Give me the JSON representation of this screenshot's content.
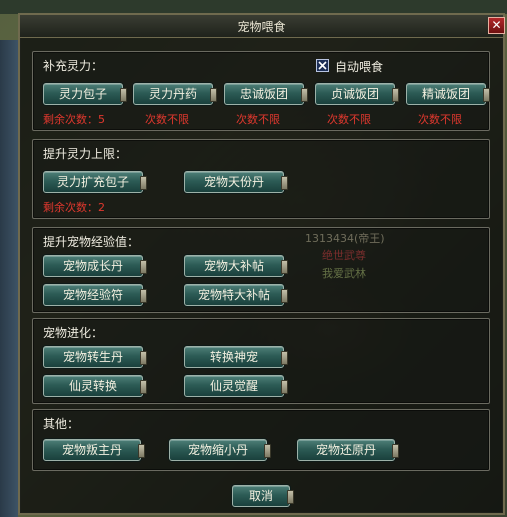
{
  "window": {
    "title": "宠物喂食",
    "close_label": "✕"
  },
  "scene": {
    "npc_id": "1313434(帝王)",
    "npc_title": "绝世武尊",
    "npc_guild": "我爱武林"
  },
  "sections": {
    "replenish": {
      "title": "补充灵力：",
      "auto_feed_label": "自动喂食",
      "auto_feed_checked": true,
      "buttons": [
        "灵力包子",
        "灵力丹药",
        "忠诚饭团",
        "贞诚饭团",
        "精诚饭团"
      ],
      "counts": [
        "剩余次数：5",
        "次数不限",
        "次数不限",
        "次数不限",
        "次数不限"
      ]
    },
    "raise_limit": {
      "title": "提升灵力上限：",
      "buttons": [
        "灵力扩充包子",
        "宠物天份丹"
      ],
      "count": "剩余次数：2"
    },
    "exp": {
      "title": "提升宠物经验值：",
      "buttons": [
        "宠物成长丹",
        "宠物大补帖",
        "宠物经验符",
        "宠物特大补帖"
      ]
    },
    "evolve": {
      "title": "宠物进化：",
      "buttons": [
        "宠物转生丹",
        "转换神宠",
        "仙灵转换",
        "仙灵觉醒"
      ]
    },
    "other": {
      "title": "其他：",
      "buttons": [
        "宠物叛主丹",
        "宠物缩小丹",
        "宠物还原丹"
      ]
    }
  },
  "footer": {
    "cancel_label": "取消"
  }
}
